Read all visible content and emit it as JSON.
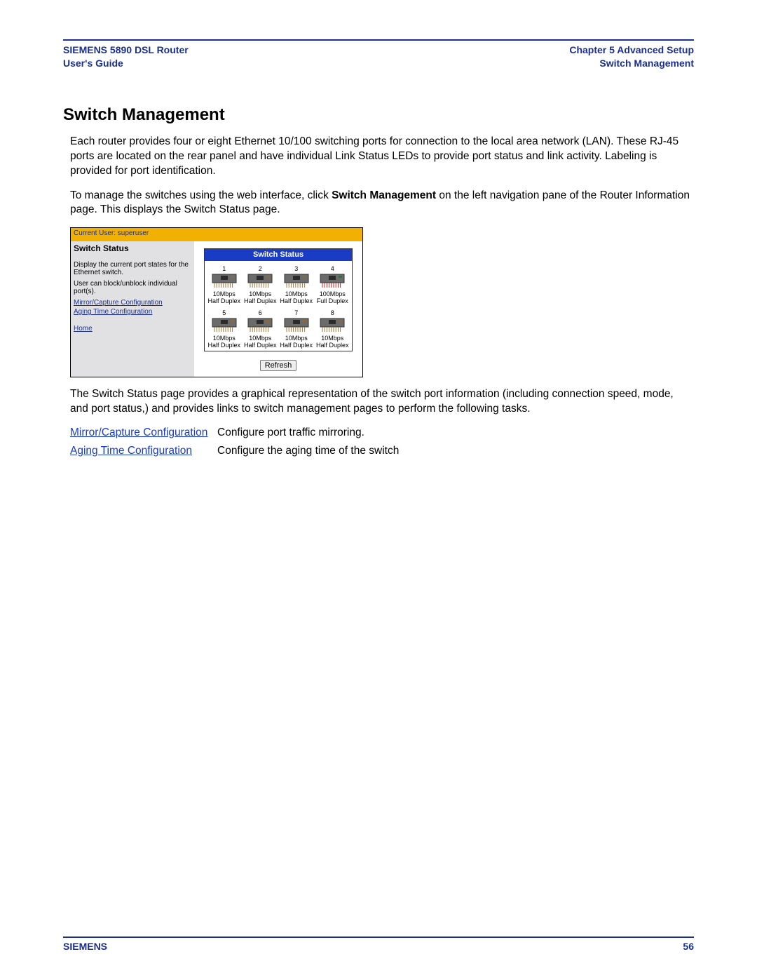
{
  "header": {
    "left_line1": "SIEMENS 5890 DSL Router",
    "left_line2": "User's Guide",
    "right_line1": "Chapter 5  Advanced Setup",
    "right_line2": "Switch Management"
  },
  "title": "Switch Management",
  "para1": "Each router provides four or eight Ethernet 10/100 switching ports for connection to the local area network (LAN). These RJ-45 ports are located on the rear panel and have individual Link Status LEDs to provide port status and link activity. Labeling is provided for port identification.",
  "para2_pre": "To manage the switches using the web interface, click ",
  "para2_bold": "Switch Management",
  "para2_post": " on the left navigation pane of the Router Information page. This displays the Switch Status page.",
  "para3": "The Switch Status page provides a graphical representation of the switch port information (including connection speed, mode, and port status,) and provides links to switch management pages to perform the following tasks.",
  "links": [
    {
      "label": "Mirror/Capture Configuration",
      "desc": "Configure port traffic mirroring."
    },
    {
      "label": "Aging Time Configuration",
      "desc": "Configure the aging time of the switch"
    }
  ],
  "screenshot": {
    "userbar": "Current User: superuser",
    "left": {
      "title": "Switch Status",
      "desc1": "Display the current port states for the Ethernet switch.",
      "desc2": "User can block/unblock individual port(s).",
      "link1": "Mirror/Capture Configuration",
      "link2": "Aging Time Configuration",
      "home": "Home"
    },
    "panel_title": "Switch Status",
    "ports": [
      {
        "num": "1",
        "speed": "10Mbps",
        "duplex": "Half Duplex",
        "color": "#8a6a3a"
      },
      {
        "num": "2",
        "speed": "10Mbps",
        "duplex": "Half Duplex",
        "color": "#8a6a3a"
      },
      {
        "num": "3",
        "speed": "10Mbps",
        "duplex": "Half Duplex",
        "color": "#8a6a3a"
      },
      {
        "num": "4",
        "speed": "100Mbps",
        "duplex": "Full Duplex",
        "color": "#0a8a22"
      },
      {
        "num": "5",
        "speed": "10Mbps",
        "duplex": "Half Duplex",
        "color": "#8a6a3a"
      },
      {
        "num": "6",
        "speed": "10Mbps",
        "duplex": "Half Duplex",
        "color": "#8a6a3a"
      },
      {
        "num": "7",
        "speed": "10Mbps",
        "duplex": "Half Duplex",
        "color": "#8a6a3a"
      },
      {
        "num": "8",
        "speed": "10Mbps",
        "duplex": "Half Duplex",
        "color": "#8a6a3a"
      }
    ],
    "refresh": "Refresh"
  },
  "footer": {
    "brand": "SIEMENS",
    "page": "56"
  }
}
